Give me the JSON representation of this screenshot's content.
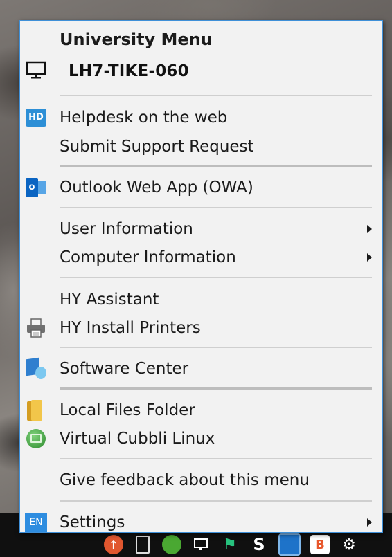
{
  "menu": {
    "title": "University Menu",
    "computer_name": "LH7-TIKE-060",
    "items": [
      {
        "id": "helpdesk",
        "label": "Helpdesk on the web",
        "icon": "helpdesk-hd-icon",
        "badge": "HD"
      },
      {
        "id": "support",
        "label": "Submit Support Request"
      },
      {
        "id": "owa",
        "label": "Outlook Web App (OWA)",
        "icon": "outlook-icon",
        "badge": "o"
      },
      {
        "id": "user-info",
        "label": "User Information",
        "submenu": true
      },
      {
        "id": "computer-info",
        "label": "Computer Information",
        "submenu": true
      },
      {
        "id": "assistant",
        "label": "HY Assistant"
      },
      {
        "id": "printers",
        "label": "HY Install Printers",
        "icon": "printer-icon"
      },
      {
        "id": "software-center",
        "label": "Software Center",
        "icon": "software-center-icon"
      },
      {
        "id": "local-files",
        "label": "Local Files Folder",
        "icon": "folder-icon"
      },
      {
        "id": "cubbli",
        "label": "Virtual Cubbli Linux",
        "icon": "virtual-linux-icon"
      },
      {
        "id": "feedback",
        "label": "Give feedback about this menu"
      },
      {
        "id": "settings",
        "label": "Settings",
        "icon": "language-en-icon",
        "badge": "EN",
        "submenu": true
      }
    ]
  },
  "taskbar": {
    "tray_b_label": "B"
  },
  "colors": {
    "menu_border": "#3f90d8",
    "menu_bg": "#f2f2f2",
    "separator": "#cfcfcf",
    "accent_blue": "#2e8de0"
  }
}
